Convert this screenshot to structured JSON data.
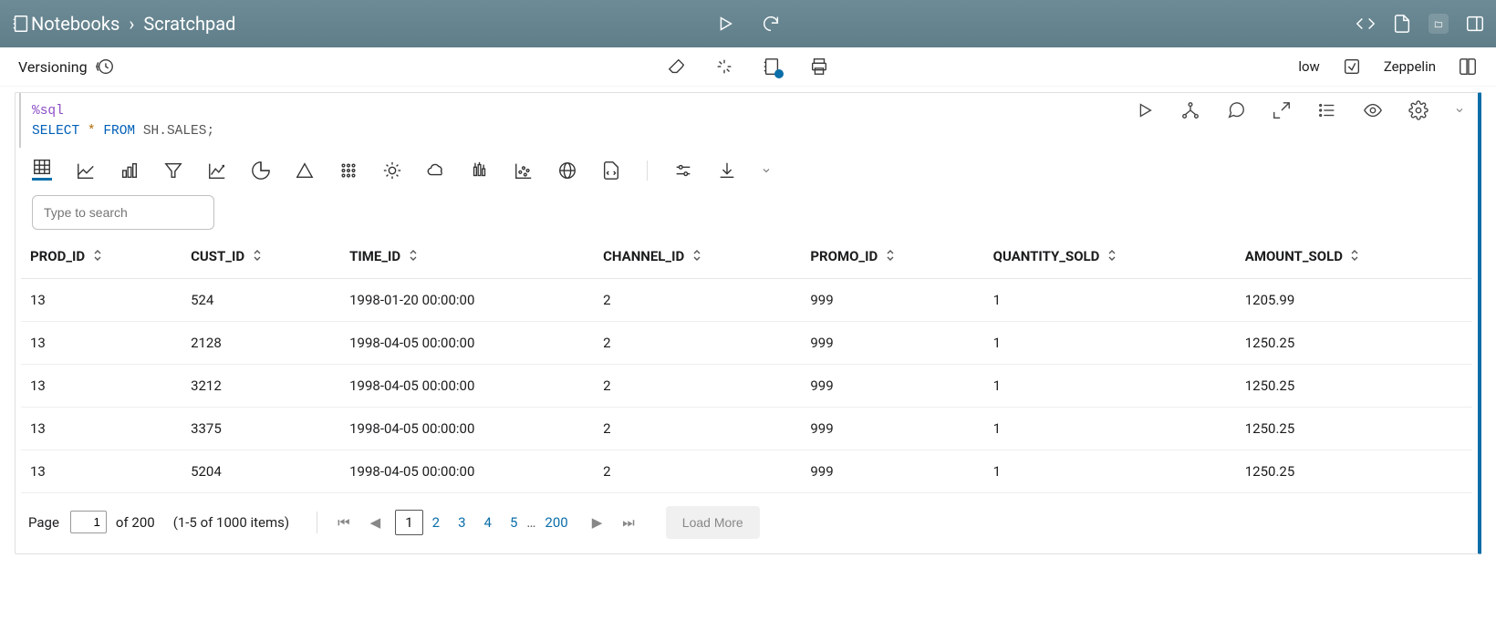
{
  "breadcrumb": {
    "root": "Notebooks",
    "current": "Scratchpad"
  },
  "toolbar": {
    "versioning": "Versioning",
    "priority_label": "low",
    "interpreter_label": "Zeppelin"
  },
  "cell": {
    "magic": "%sql",
    "code_select": "SELECT",
    "code_star": "*",
    "code_from": "FROM",
    "code_table": "SH.SALES;"
  },
  "search": {
    "placeholder": "Type to search"
  },
  "table": {
    "columns": [
      "PROD_ID",
      "CUST_ID",
      "TIME_ID",
      "CHANNEL_ID",
      "PROMO_ID",
      "QUANTITY_SOLD",
      "AMOUNT_SOLD"
    ],
    "rows": [
      {
        "PROD_ID": "13",
        "CUST_ID": "524",
        "TIME_ID": "1998-01-20 00:00:00",
        "CHANNEL_ID": "2",
        "PROMO_ID": "999",
        "QUANTITY_SOLD": "1",
        "AMOUNT_SOLD": "1205.99"
      },
      {
        "PROD_ID": "13",
        "CUST_ID": "2128",
        "TIME_ID": "1998-04-05 00:00:00",
        "CHANNEL_ID": "2",
        "PROMO_ID": "999",
        "QUANTITY_SOLD": "1",
        "AMOUNT_SOLD": "1250.25"
      },
      {
        "PROD_ID": "13",
        "CUST_ID": "3212",
        "TIME_ID": "1998-04-05 00:00:00",
        "CHANNEL_ID": "2",
        "PROMO_ID": "999",
        "QUANTITY_SOLD": "1",
        "AMOUNT_SOLD": "1250.25"
      },
      {
        "PROD_ID": "13",
        "CUST_ID": "3375",
        "TIME_ID": "1998-04-05 00:00:00",
        "CHANNEL_ID": "2",
        "PROMO_ID": "999",
        "QUANTITY_SOLD": "1",
        "AMOUNT_SOLD": "1250.25"
      },
      {
        "PROD_ID": "13",
        "CUST_ID": "5204",
        "TIME_ID": "1998-04-05 00:00:00",
        "CHANNEL_ID": "2",
        "PROMO_ID": "999",
        "QUANTITY_SOLD": "1",
        "AMOUNT_SOLD": "1250.25"
      }
    ]
  },
  "pager": {
    "page_label": "Page",
    "page_value": "1",
    "of_label": "of 200",
    "range_label": "(1-5 of 1000 items)",
    "pages": [
      "1",
      "2",
      "3",
      "4",
      "5",
      "…",
      "200"
    ],
    "load_more": "Load More"
  }
}
